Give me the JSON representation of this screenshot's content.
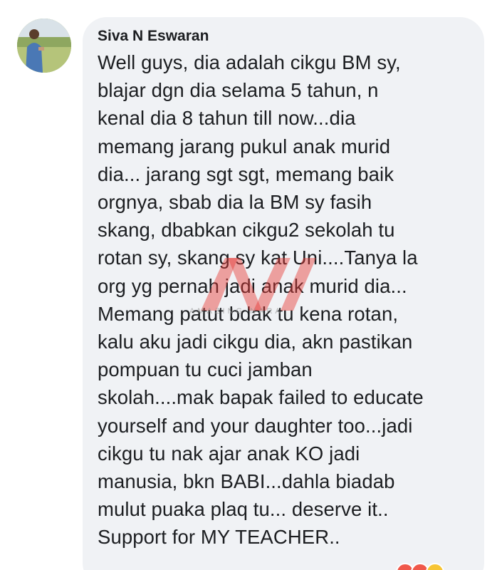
{
  "comment": {
    "author": "Siva N Eswaran",
    "lines": [
      "Well guys, dia adalah cikgu BM sy,",
      "blajar dgn dia selama 5 tahun, n",
      "kenal dia 8 tahun till now...dia",
      "memang jarang pukul anak murid",
      "dia... jarang sgt sgt, memang baik",
      "orgnya, sbab dia la BM sy fasih",
      "skang, dbabkan cikgu2 sekolah tu",
      "rotan sy, skang sy kat Uni....Tanya la",
      "org yg pernah jadi anak murid dia...",
      "Memang patut bdak tu kena rotan,",
      "kalu aku jadi cikgu dia, akn pastikan",
      "pompuan tu cuci jamban",
      "skolah....mak bapak failed to educate",
      "yourself and your daughter too...jadi",
      "cikgu tu nak ajar anak KO jadi",
      "manusia, bkn BABI...dahla biadab",
      "mulut puaka plaq tu... deserve it..",
      "Support for MY TEACHER.."
    ]
  },
  "watermark": {
    "text": "AMAZING NARA",
    "color": "#e63a35"
  },
  "reactions": {
    "icons": [
      "angry-icon",
      "haha-icon",
      "wow-icon"
    ],
    "colors": [
      "#f0584a",
      "#f0584a",
      "#f7c534"
    ]
  }
}
